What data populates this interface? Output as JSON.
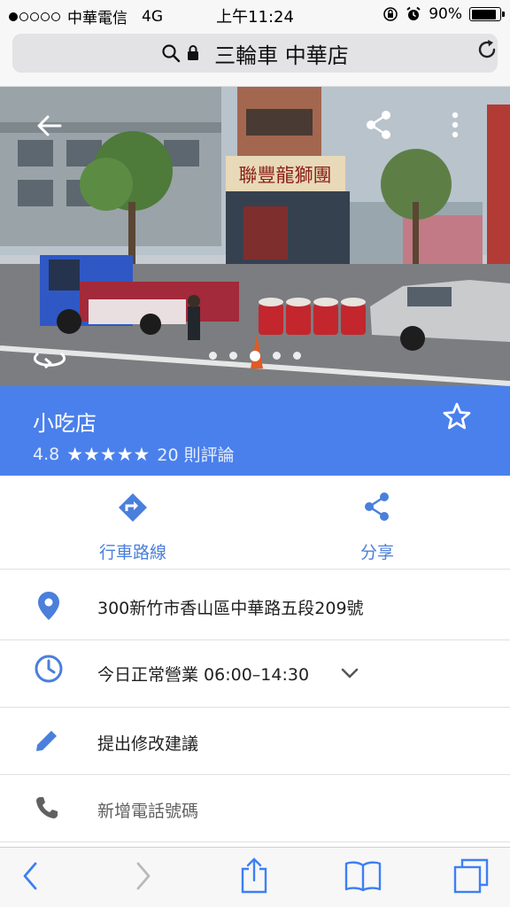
{
  "status_bar": {
    "carrier": "中華電信",
    "network": "4G",
    "time": "上午11:24",
    "battery": "90%",
    "battery_level": 0.9
  },
  "address_bar": {
    "title": "三輪車 中華店",
    "icons": [
      "search-icon",
      "lock-icon",
      "reload-icon"
    ]
  },
  "street_view": {
    "shop_sign": "聯豐龍獅團",
    "pager": {
      "count": 5,
      "active_index": 2
    },
    "icons": [
      "back-arrow-icon",
      "share-icon",
      "more-vert-icon",
      "rotate-360-icon"
    ]
  },
  "place": {
    "name": "小吃店",
    "rating": "4.8",
    "stars": "★★★★★",
    "reviews": "20 則評論",
    "save_icon": "star-outline-icon",
    "accent_color": "#4a80ec"
  },
  "actions": [
    {
      "label": "行車路線",
      "icon": "directions-icon"
    },
    {
      "label": "分享",
      "icon": "share-icon"
    }
  ],
  "info": {
    "address": "300新竹市香山區中華路五段209號",
    "hours": "今日正常營業 06:00–14:30",
    "suggest_edit": "提出修改建議",
    "add_phone": "新增電話號碼"
  },
  "toolbar": {
    "icons": [
      "back-icon",
      "forward-icon",
      "share-icon",
      "bookmarks-icon",
      "tabs-icon"
    ]
  }
}
